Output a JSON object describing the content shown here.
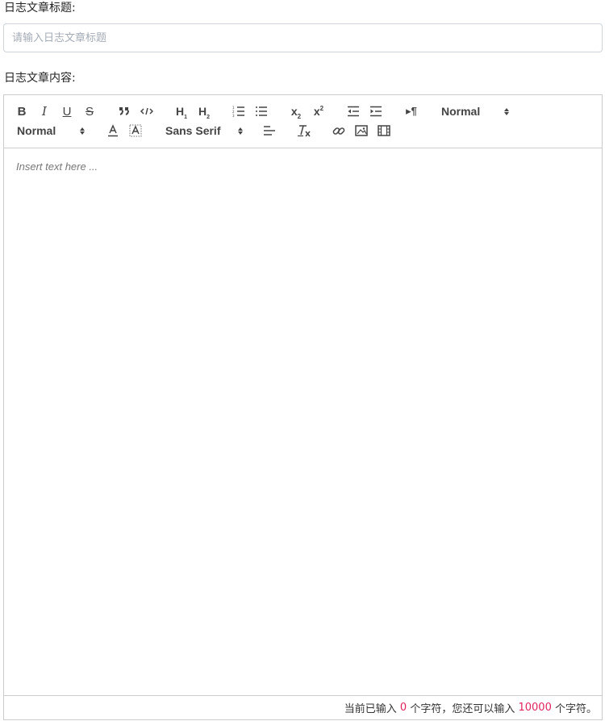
{
  "form": {
    "title_label": "日志文章标题:",
    "title_placeholder": "请输入日志文章标题",
    "title_value": "",
    "content_label": "日志文章内容:"
  },
  "toolbar": {
    "bold": "B",
    "italic": "I",
    "underline": "U",
    "strike": "S",
    "header1": {
      "main": "H",
      "sub": "1"
    },
    "header2": {
      "main": "H",
      "sub": "2"
    },
    "subscript": {
      "main": "x",
      "sub": "2"
    },
    "superscript": {
      "main": "x",
      "sup": "2"
    },
    "direction": "▸¶",
    "size_picker": "Normal",
    "header_picker": "Normal",
    "font_picker": "Sans Serif",
    "icons": [
      "blockquote-icon",
      "code-block-icon",
      "ordered-list-icon",
      "bullet-list-icon",
      "indent-decrease-icon",
      "indent-increase-icon",
      "text-color-icon",
      "background-color-icon",
      "align-icon",
      "clear-format-icon",
      "link-icon",
      "image-icon",
      "video-icon"
    ]
  },
  "editor": {
    "placeholder": "Insert text here ..."
  },
  "status": {
    "prefix": "当前已输入",
    "current_count": "0",
    "middle": "个字符，您还可以输入",
    "remaining_count": "10000",
    "suffix": "个字符。"
  },
  "colors": {
    "border": "#cccccc",
    "input_border": "#cfd4da",
    "icon": "#444444",
    "count_highlight": "#e0245e"
  }
}
